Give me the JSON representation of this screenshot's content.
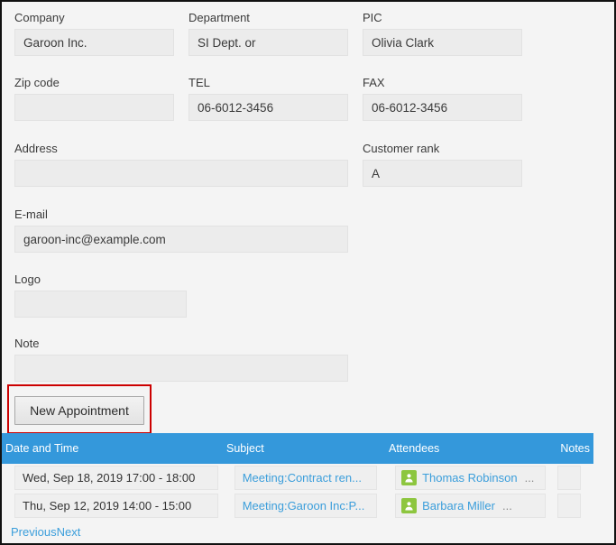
{
  "form": {
    "fields": [
      {
        "name": "company",
        "label": "Company",
        "value": "Garoon Inc."
      },
      {
        "name": "department",
        "label": "Department",
        "value": "SI Dept. or"
      },
      {
        "name": "pic",
        "label": "PIC",
        "value": "Olivia Clark"
      },
      {
        "name": "zip-code",
        "label": "Zip code",
        "value": ""
      },
      {
        "name": "tel",
        "label": "TEL",
        "value": "06-6012-3456"
      },
      {
        "name": "fax",
        "label": "FAX",
        "value": "06-6012-3456"
      },
      {
        "name": "address",
        "label": "Address",
        "value": ""
      },
      {
        "name": "customer-rank",
        "label": "Customer rank",
        "value": "A"
      },
      {
        "name": "email",
        "label": "E-mail",
        "value": "garoon-inc@example.com"
      },
      {
        "name": "logo",
        "label": "Logo",
        "value": ""
      },
      {
        "name": "note",
        "label": "Note",
        "value": ""
      }
    ]
  },
  "actions": {
    "new_appointment_label": "New Appointment"
  },
  "appointments": {
    "columns": [
      "Date and Time",
      "Subject",
      "Attendees",
      "Notes"
    ],
    "rows": [
      {
        "date_time": "Wed, Sep 18, 2019 17:00 - 18:00",
        "subject": "Meeting:Contract ren...",
        "attendee": "Thomas Robinson",
        "attendee_more": "...",
        "notes": ""
      },
      {
        "date_time": "Thu, Sep 12, 2019 14:00 - 15:00",
        "subject": "Meeting:Garoon Inc:P...",
        "attendee": "Barbara Miller",
        "attendee_more": "...",
        "notes": ""
      }
    ]
  },
  "pagination": {
    "previous_label": "Previous",
    "next_label": "Next"
  },
  "colors": {
    "header_blue": "#3498db",
    "link_blue": "#3b9edb",
    "highlight_red": "#cc0000",
    "avatar_green": "#8dc63f"
  }
}
